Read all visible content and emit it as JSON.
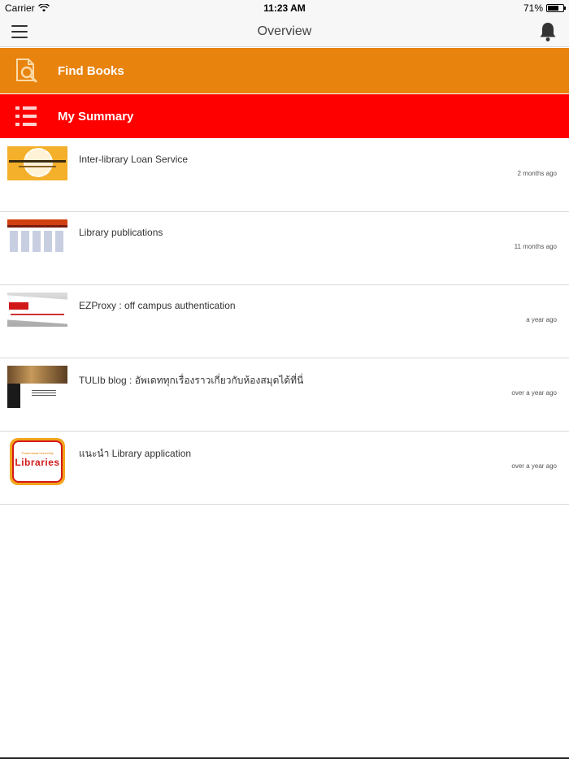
{
  "status_bar": {
    "carrier": "Carrier",
    "time": "11:23 AM",
    "battery": "71%",
    "battery_level": 0.71
  },
  "nav": {
    "title": "Overview",
    "menu_icon": "hamburger-menu-icon",
    "bell_icon": "bell-icon"
  },
  "banners": {
    "find_books": {
      "label": "Find Books",
      "color": "#e8830e",
      "icon": "search-book-icon"
    },
    "my_summary": {
      "label": "My Summary",
      "color": "#ff0000",
      "icon": "list-icon"
    }
  },
  "items": [
    {
      "title": "Inter-library Loan Service",
      "time": "2 months ago"
    },
    {
      "title": "Library publications",
      "time": "11 months ago"
    },
    {
      "title": "EZProxy : off campus authentication",
      "time": "a year ago"
    },
    {
      "title": "TULIb blog : อัพเดททุกเรื่องราวเกี่ยวกับห้องสมุดได้ที่นี่",
      "time": "over a year ago"
    },
    {
      "title": "แนะนำ Library application",
      "time": "over a year ago"
    }
  ],
  "thumb_logo": {
    "top": "Thammasat University",
    "main": "Libraries"
  }
}
